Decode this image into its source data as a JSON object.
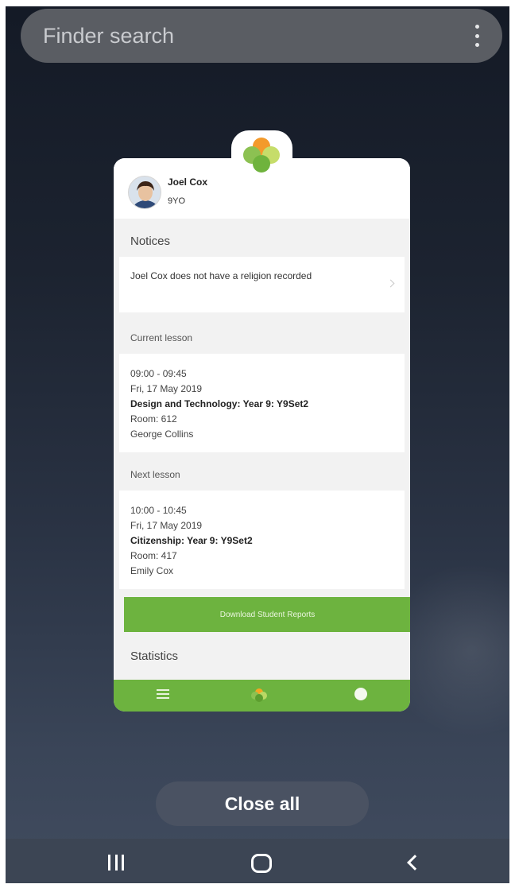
{
  "finder": {
    "placeholder": "Finder search"
  },
  "app_card": {
    "student": {
      "name": "Joel Cox",
      "class": "9YO"
    },
    "notices": {
      "heading": "Notices",
      "message": "Joel Cox does not have a religion recorded"
    },
    "current_lesson": {
      "heading": "Current lesson",
      "time": "09:00 - 09:45",
      "date": "Fri, 17 May 2019",
      "subject": "Design and Technology: Year 9: Y9Set2",
      "room": "Room: 612",
      "teacher": "George Collins"
    },
    "next_lesson": {
      "heading": "Next lesson",
      "time": "10:00 - 10:45",
      "date": "Fri, 17 May 2019",
      "subject": "Citizenship: Year 9: Y9Set2",
      "room": "Room: 417",
      "teacher": "Emily Cox"
    },
    "download_button": "Download Student Reports",
    "statistics_heading": "Statistics",
    "accent_color": "#6db33f"
  },
  "close_all": "Close all",
  "icons": {
    "kebab": "more-vertical-icon",
    "app": "multicolor-leaf-logo",
    "recents": "recents-icon",
    "home": "home-icon",
    "back": "back-icon"
  }
}
